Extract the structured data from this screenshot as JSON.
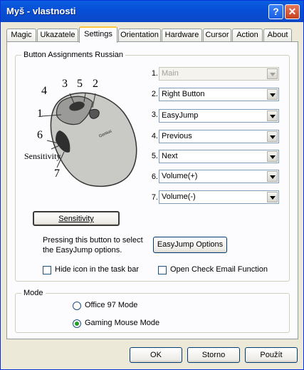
{
  "window": {
    "title": "Myš - vlastnosti",
    "help_glyph": "?",
    "close_glyph": "✕"
  },
  "tabs": [
    "Magic",
    "Ukazatele",
    "Settings",
    "Orientation",
    "Hardware",
    "Cursor",
    "Action",
    "About"
  ],
  "active_tab": "Settings",
  "assignments": {
    "group_label": "Button  Assignments Russian",
    "image_labels": {
      "n1": "1",
      "n2": "2",
      "n3": "3",
      "n4": "4",
      "n5": "5",
      "n6": "6",
      "n7": "7",
      "sensitivity": "Sensitivity",
      "brand": "Genius"
    },
    "buttons": [
      {
        "num": "1.",
        "value": "Main",
        "disabled": true
      },
      {
        "num": "2.",
        "value": "Right Button"
      },
      {
        "num": "3.",
        "value": "EasyJump"
      },
      {
        "num": "4.",
        "value": "Previous"
      },
      {
        "num": "5.",
        "value": "Next"
      },
      {
        "num": "6.",
        "value": "Volume(+)"
      },
      {
        "num": "7.",
        "value": "Volume(-)"
      }
    ],
    "sensitivity_button": "Sensitivity",
    "easyjump_note_line1": "Pressing this button to select",
    "easyjump_note_line2": "the EasyJump options.",
    "easyjump_options_button": "EasyJump Options",
    "hide_icon_label": "Hide icon in the task bar",
    "open_check_email_label": "Open Check Email Function"
  },
  "mode": {
    "group_label": "Mode",
    "options": [
      {
        "label": "Office 97 Mode",
        "selected": false
      },
      {
        "label": "Gaming Mouse Mode",
        "selected": true
      }
    ]
  },
  "footer": {
    "ok": "OK",
    "cancel": "Storno",
    "apply": "Použít"
  },
  "colors": {
    "title_bar": "#0A5FE0",
    "tab_highlight": "#FFC83C",
    "radio_dot": "#21A121"
  }
}
